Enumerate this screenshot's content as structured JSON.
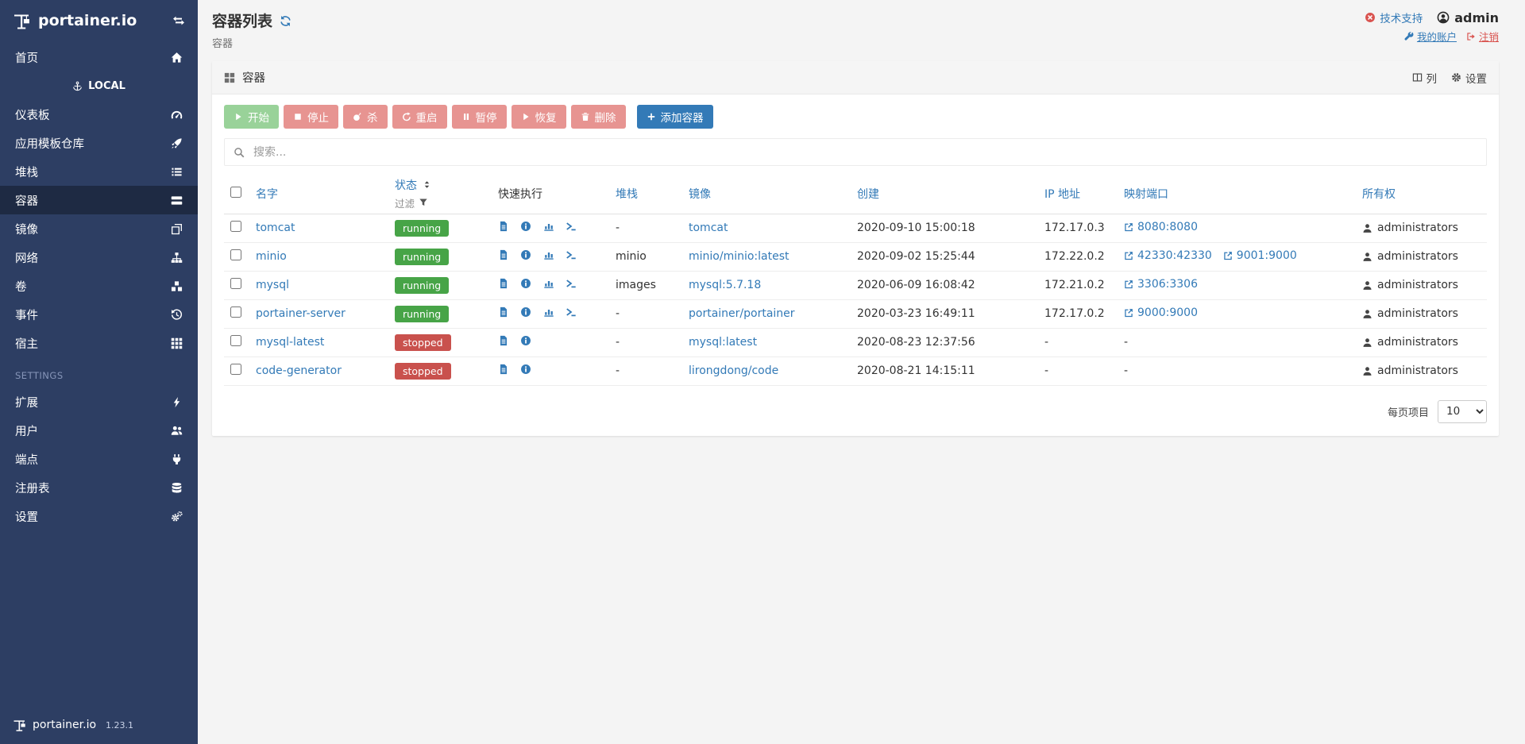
{
  "colors": {
    "accent": "#337ab7",
    "sidebar_bg": "#2d3e63",
    "success": "#5cb85c",
    "danger": "#d9534f",
    "running_badge": "#47a447",
    "stopped_badge": "#c9514d"
  },
  "app": {
    "brand": "portainer.io",
    "version": "1.23.1"
  },
  "sidebar": {
    "home_label": "首页",
    "endpoint_label": "LOCAL",
    "items": [
      {
        "id": "dashboard",
        "label": "仪表板",
        "icon": "tachometer"
      },
      {
        "id": "app-templates",
        "label": "应用模板仓库",
        "icon": "rocket"
      },
      {
        "id": "stacks",
        "label": "堆栈",
        "icon": "list"
      },
      {
        "id": "containers",
        "label": "容器",
        "icon": "server",
        "active": true
      },
      {
        "id": "images",
        "label": "镜像",
        "icon": "clone"
      },
      {
        "id": "networks",
        "label": "网络",
        "icon": "sitemap"
      },
      {
        "id": "volumes",
        "label": "卷",
        "icon": "cubes"
      },
      {
        "id": "events",
        "label": "事件",
        "icon": "history"
      },
      {
        "id": "host",
        "label": "宿主",
        "icon": "grid"
      }
    ],
    "settings_label": "SETTINGS",
    "settings_items": [
      {
        "id": "extensions",
        "label": "扩展",
        "icon": "bolt"
      },
      {
        "id": "users",
        "label": "用户",
        "icon": "users"
      },
      {
        "id": "endpoints",
        "label": "端点",
        "icon": "plug"
      },
      {
        "id": "registries",
        "label": "注册表",
        "icon": "database"
      },
      {
        "id": "settings",
        "label": "设置",
        "icon": "cogs"
      }
    ]
  },
  "header": {
    "title": "容器列表",
    "subtitle": "容器",
    "support_label": "技术支持",
    "username": "admin",
    "my_account_label": "我的账户",
    "logout_label": "注销"
  },
  "panel": {
    "title": "容器",
    "columns_label": "列",
    "settings_label": "设置",
    "toolbar": {
      "start": "开始",
      "stop": "停止",
      "kill": "杀",
      "restart": "重启",
      "pause": "暂停",
      "resume": "恢复",
      "remove": "删除",
      "add": "添加容器"
    },
    "search_placeholder": "搜索...",
    "table": {
      "headers": {
        "name": "名字",
        "state": "状态",
        "filter": "过滤",
        "quick_actions": "快速执行",
        "stack": "堆栈",
        "image": "镜像",
        "created": "创建",
        "ip": "IP 地址",
        "ports": "映射端口",
        "ownership": "所有权"
      },
      "empty_placeholder": "-",
      "rows": [
        {
          "name": "tomcat",
          "state": "running",
          "stack": "-",
          "image": "tomcat",
          "created": "2020-09-10 15:00:18",
          "ip": "172.17.0.3",
          "ports": [
            "8080:8080"
          ],
          "ownership": "administrators"
        },
        {
          "name": "minio",
          "state": "running",
          "stack": "minio",
          "image": "minio/minio:latest",
          "created": "2020-09-02 15:25:44",
          "ip": "172.22.0.2",
          "ports": [
            "42330:42330",
            "9001:9000"
          ],
          "ownership": "administrators"
        },
        {
          "name": "mysql",
          "state": "running",
          "stack": "images",
          "image": "mysql:5.7.18",
          "created": "2020-06-09 16:08:42",
          "ip": "172.21.0.2",
          "ports": [
            "3306:3306"
          ],
          "ownership": "administrators"
        },
        {
          "name": "portainer-server",
          "state": "running",
          "stack": "-",
          "image": "portainer/portainer",
          "created": "2020-03-23 16:49:11",
          "ip": "172.17.0.2",
          "ports": [
            "9000:9000"
          ],
          "ownership": "administrators"
        },
        {
          "name": "mysql-latest",
          "state": "stopped",
          "stack": "-",
          "image": "mysql:latest",
          "created": "2020-08-23 12:37:56",
          "ip": "-",
          "ports": [],
          "ownership": "administrators"
        },
        {
          "name": "code-generator",
          "state": "stopped",
          "stack": "-",
          "image": "lirongdong/code",
          "created": "2020-08-21 14:15:11",
          "ip": "-",
          "ports": [],
          "ownership": "administrators"
        }
      ]
    },
    "pagination": {
      "label": "每页项目",
      "selected": "10",
      "options": [
        "10"
      ]
    }
  }
}
